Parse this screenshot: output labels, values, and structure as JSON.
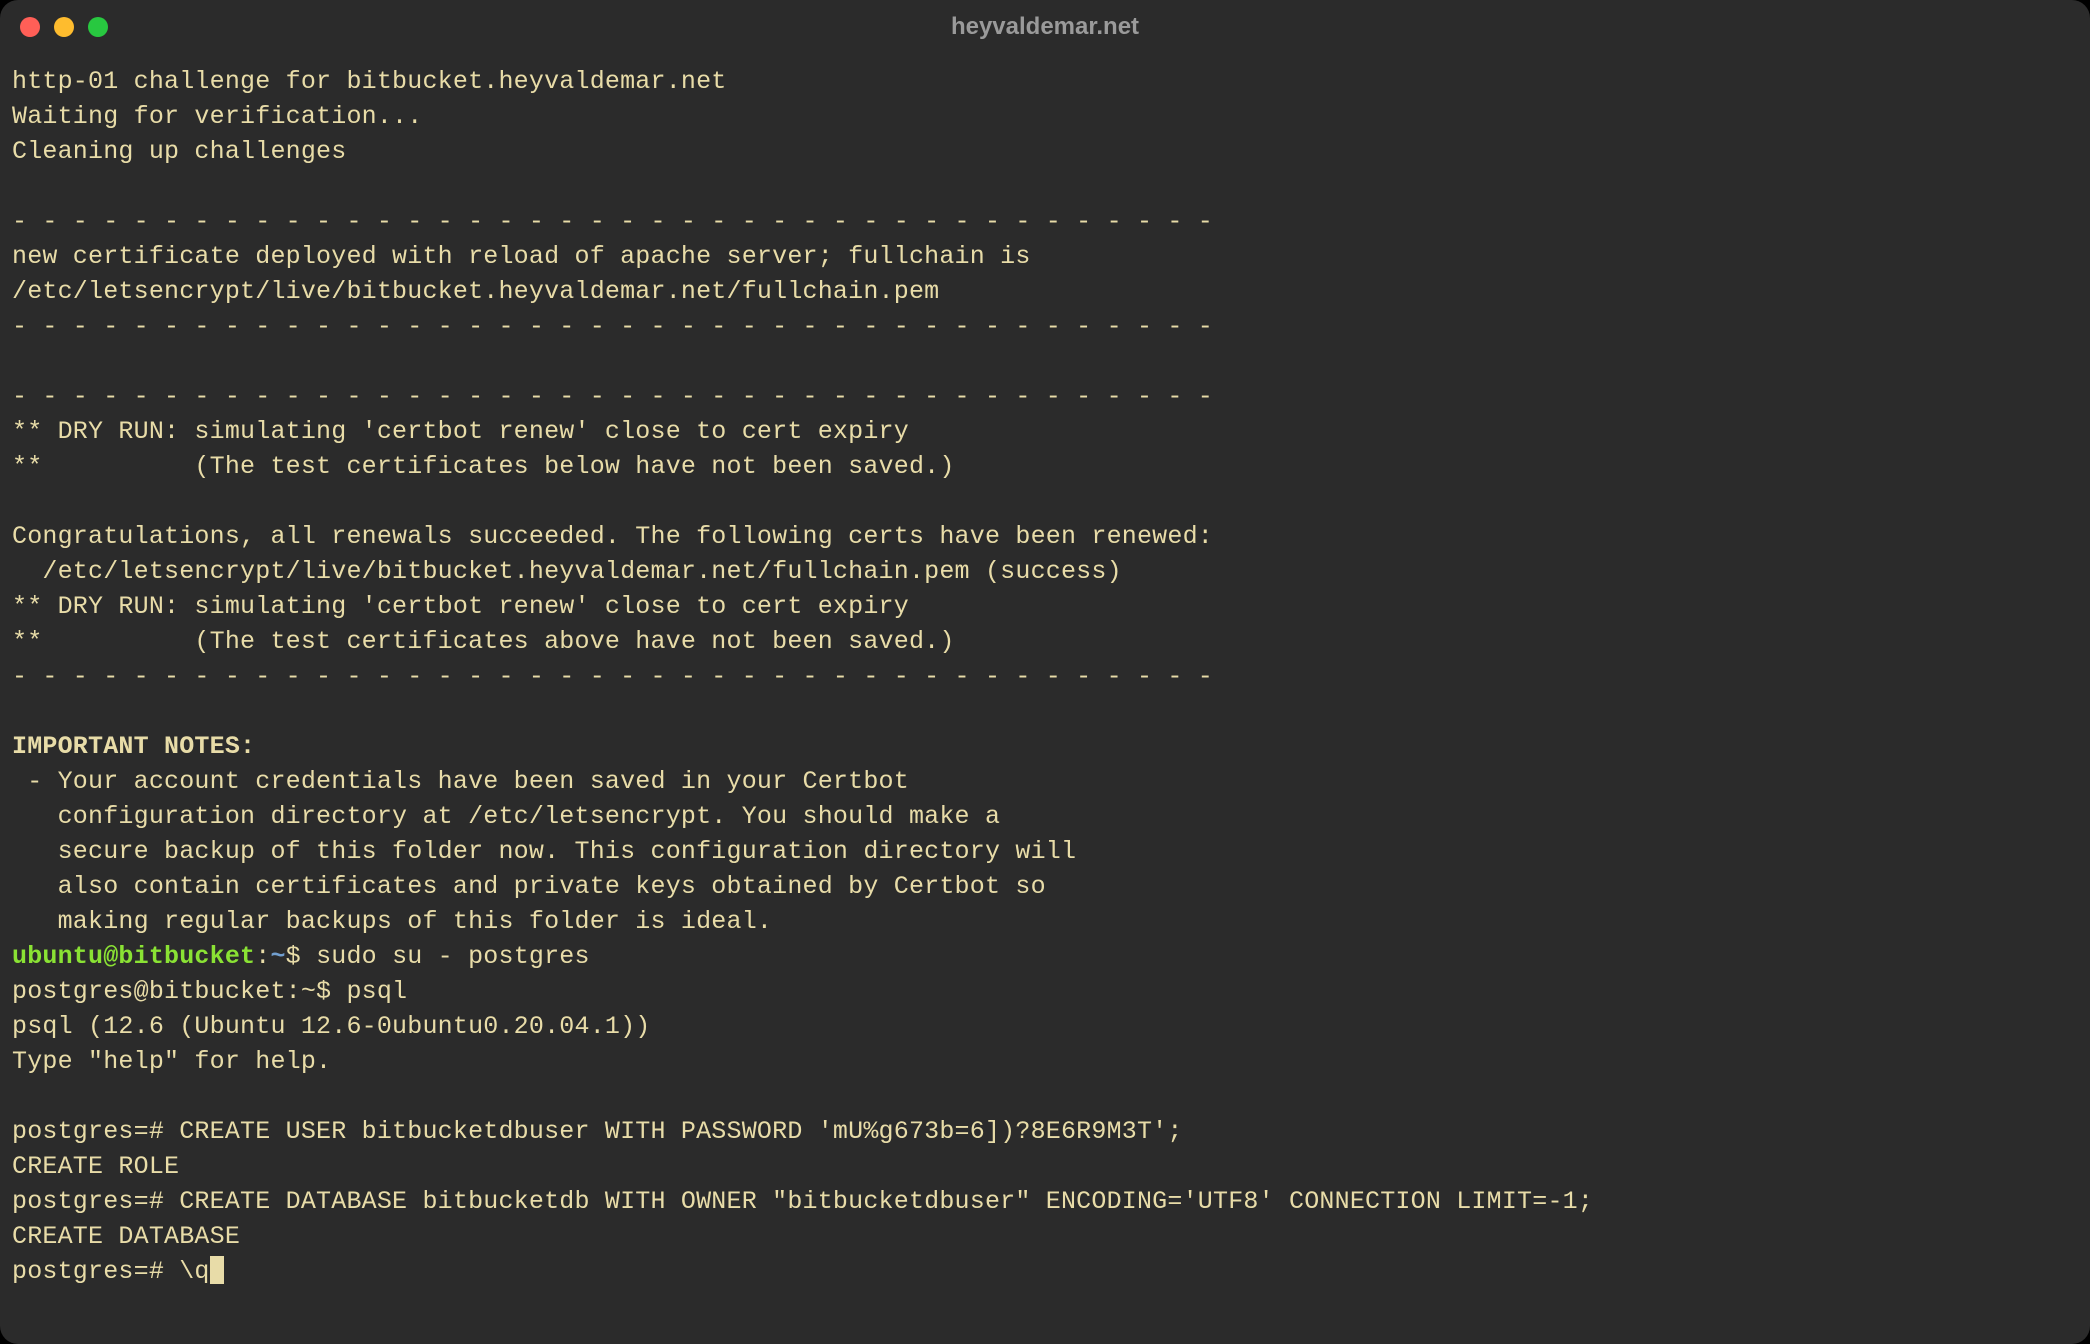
{
  "window": {
    "title": "heyvaldemar.net"
  },
  "lines": {
    "l01": "http-01 challenge for bitbucket.heyvaldemar.net",
    "l02": "Waiting for verification...",
    "l03": "Cleaning up challenges",
    "l04": "",
    "l05": "- - - - - - - - - - - - - - - - - - - - - - - - - - - - - - - - - - - - - - - -",
    "l06": "new certificate deployed with reload of apache server; fullchain is",
    "l07": "/etc/letsencrypt/live/bitbucket.heyvaldemar.net/fullchain.pem",
    "l08": "- - - - - - - - - - - - - - - - - - - - - - - - - - - - - - - - - - - - - - - -",
    "l09": "",
    "l10": "- - - - - - - - - - - - - - - - - - - - - - - - - - - - - - - - - - - - - - - -",
    "l11": "** DRY RUN: simulating 'certbot renew' close to cert expiry",
    "l12": "**          (The test certificates below have not been saved.)",
    "l13": "",
    "l14": "Congratulations, all renewals succeeded. The following certs have been renewed:",
    "l15": "  /etc/letsencrypt/live/bitbucket.heyvaldemar.net/fullchain.pem (success)",
    "l16": "** DRY RUN: simulating 'certbot renew' close to cert expiry",
    "l17": "**          (The test certificates above have not been saved.)",
    "l18": "- - - - - - - - - - - - - - - - - - - - - - - - - - - - - - - - - - - - - - - -",
    "l19": "",
    "l20": "IMPORTANT NOTES:",
    "l21": " - Your account credentials have been saved in your Certbot",
    "l22": "   configuration directory at /etc/letsencrypt. You should make a",
    "l23": "   secure backup of this folder now. This configuration directory will",
    "l24": "   also contain certificates and private keys obtained by Certbot so",
    "l25": "   making regular backups of this folder is ideal.",
    "prompt1_user": "ubuntu@bitbucket",
    "prompt1_sep": ":",
    "prompt1_path": "~",
    "prompt1_dollar": "$ ",
    "prompt1_cmd": "sudo su - postgres",
    "l27": "postgres@bitbucket:~$ psql",
    "l28": "psql (12.6 (Ubuntu 12.6-0ubuntu0.20.04.1))",
    "l29": "Type \"help\" for help.",
    "l30": "",
    "l31": "postgres=# CREATE USER bitbucketdbuser WITH PASSWORD 'mU%g673b=6])?8E6R9M3T';",
    "l32": "CREATE ROLE",
    "l33": "postgres=# CREATE DATABASE bitbucketdb WITH OWNER \"bitbucketdbuser\" ENCODING='UTF8' CONNECTION LIMIT=-1;",
    "l34": "CREATE DATABASE",
    "l35": "postgres=# \\q"
  }
}
